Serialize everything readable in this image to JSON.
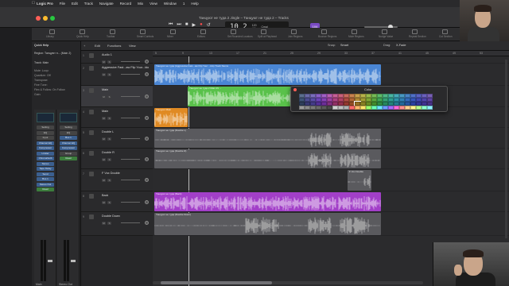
{
  "menubar": {
    "apple": "",
    "items": [
      "Logic Pro",
      "File",
      "Edit",
      "Track",
      "Navigate",
      "Record",
      "Mix",
      "View",
      "Window",
      "1",
      "Help"
    ],
    "clock": ""
  },
  "window": {
    "title": "Танцуют не туда 2 Jingle – Танцуют не туда 2 – Tracks"
  },
  "transport": {
    "buttons": [
      "⏮",
      "⏭",
      "■",
      "▶",
      "●",
      "↺"
    ],
    "bar_beat": "10 2",
    "tempo_small": "120",
    "key_small": "4/4",
    "key_name": "Cmaj",
    "key_badge": "104"
  },
  "toolbar": {
    "tools": [
      {
        "label": "Library",
        "icon": "library-icon"
      },
      {
        "label": "Quick Help",
        "icon": "quick-help-icon"
      },
      {
        "label": "Toolbar",
        "icon": "toolbar-icon"
      },
      {
        "label": "Smart Controls",
        "icon": "smart-controls-icon"
      },
      {
        "label": "Mixer",
        "icon": "mixer-icon"
      },
      {
        "label": "Editors",
        "icon": "editors-icon"
      },
      {
        "label": "Set Rounded Locators",
        "icon": "locators-icon"
      },
      {
        "label": "Split at Playhead",
        "icon": "split-icon"
      },
      {
        "label": "Join Regions",
        "icon": "join-icon"
      },
      {
        "label": "Bounce Regions",
        "icon": "bounce-icon"
      },
      {
        "label": "Mute Regions",
        "icon": "mute-icon"
      },
      {
        "label": "Nudge Value",
        "icon": "nudge-icon"
      },
      {
        "label": "Repeat Section",
        "icon": "repeat-icon"
      },
      {
        "label": "Cut Section",
        "icon": "cut-icon"
      },
      {
        "label": "Insert Silence",
        "icon": "insert-icon"
      }
    ]
  },
  "inspector": {
    "quick_help": "Quick Help",
    "region_label": "Region: Танцуют н... (Main 2)",
    "track_label": "Track: Main",
    "rows": [
      "Mute: Loop:",
      "Quantize: Off",
      "Transpose:",
      "Fine Tune:",
      "Flex & Follow: On Follow",
      "Gain:",
      "Fade In:",
      "Fade Out: Off"
    ],
    "strip1_name": "Main",
    "strip2_name": "Stereo Out",
    "strip1_buttons": [
      "Setting",
      "EQ",
      "Input",
      "Channel EQ",
      "Compressor",
      "Limiter",
      "ChromaVerb",
      "Stereo",
      "Tape Delay",
      "Send",
      "Bus 1",
      "Stereo Out",
      "Read"
    ],
    "strip2_buttons": [
      "Setting",
      "EQ",
      "Bus 1",
      "Channel EQ",
      "Compressor",
      "Group",
      "Read"
    ],
    "strip1_values": [
      "-0.0",
      "0.0"
    ],
    "strip2_values": [
      "0.0",
      "0.0"
    ]
  },
  "arrange_header": {
    "edit": "Edit",
    "functions": "Functions",
    "view": "View",
    "snap_label": "Snap:",
    "snap_value": "Smart",
    "drag_label": "Drag:",
    "drag_value": "X-Fade"
  },
  "ruler": {
    "ticks": [
      "5",
      "9",
      "13",
      "17",
      "21",
      "25",
      "29",
      "33",
      "37",
      "41",
      "45",
      "49",
      "53"
    ]
  },
  "tracks": [
    {
      "num": "1",
      "name": "Audio 1",
      "h": 16
    },
    {
      "num": "2",
      "name": "Aggressive Fast...aw Flip Your...ldo",
      "h": 28
    },
    {
      "num": "3",
      "name": "Main",
      "h": 27
    },
    {
      "num": "4",
      "name": "Main",
      "h": 26
    },
    {
      "num": "5",
      "name": "Double L",
      "h": 26
    },
    {
      "num": "6",
      "name": "Double R",
      "h": 26
    },
    {
      "num": "7",
      "name": "F Vox Double",
      "h": 28
    },
    {
      "num": "8",
      "name": "Back",
      "h": 26
    },
    {
      "num": "9",
      "name": "Double Down",
      "h": 30
    }
  ],
  "regions": [
    {
      "lane": 1,
      "label": "Танцуют не туда (Aggressive Fast...aw Flip Your ...ldo) Track Stems",
      "color": "#4a86d4",
      "start": 2,
      "end": 287
    },
    {
      "lane": 2,
      "label": "Танцуют не туда 2 Main #1 ...",
      "color": "#59c14a",
      "start": 44,
      "end": 287
    },
    {
      "lane": 3,
      "label": "Танцуют Main",
      "color": "#e08a23",
      "start": 2,
      "end": 44
    },
    {
      "lane": 4,
      "label": "Танцуют не туда (Double L)",
      "color": "#5a5a5e",
      "start": 2,
      "end": 287
    },
    {
      "lane": 5,
      "label": "Танцуют не туда (Double R)",
      "color": "#5a5a5e",
      "start": 2,
      "end": 287
    },
    {
      "lane": 6,
      "label": "F Vox Double",
      "color": "#5a5a5e",
      "start": 245,
      "end": 275
    },
    {
      "lane": 7,
      "label": "Танцуют не туда (Back)",
      "color": "#a23fc8",
      "start": 2,
      "end": 287
    },
    {
      "lane": 8,
      "label": "Танцуют не туда (Double Down)",
      "color": "#5a5a5e",
      "start": 2,
      "end": 287
    }
  ],
  "color_popup": {
    "title": "Color",
    "palette": [
      "#5a6e8e",
      "#6a6aa8",
      "#7a6cbc",
      "#8a60c8",
      "#a15fc6",
      "#b85fb4",
      "#c65f96",
      "#c8607a",
      "#c86a5e",
      "#c8824e",
      "#c8a04c",
      "#b8b24a",
      "#9abb4c",
      "#76bb55",
      "#5cbb6a",
      "#4fb886",
      "#48b4a2",
      "#46aab8",
      "#4898c2",
      "#4a84c6",
      "#5070c8",
      "#5a62c2",
      "#6a60bc",
      "#7860b4",
      "#3f5476",
      "#4c4c90",
      "#5a4ea6",
      "#6c44b8",
      "#8642b6",
      "#9e42a0",
      "#ae4282",
      "#b04264",
      "#b04c42",
      "#b06636",
      "#b08834",
      "#a29c34",
      "#80a636",
      "#58a63e",
      "#40a656",
      "#34a274",
      "#2e9e92",
      "#2e94aa",
      "#3080b4",
      "#326aba",
      "#3656ba",
      "#4048b2",
      "#5044aa",
      "#5e44a2",
      "#2e3e5a",
      "#383872",
      "#443c88",
      "#543098",
      "#6c2e98",
      "#823082",
      "#923066",
      "#94304c",
      "#94382e",
      "#944e24",
      "#946e22",
      "#888222",
      "#688c24",
      "#428c2c",
      "#2e8c42",
      "#26885e",
      "#22847a",
      "#227a90",
      "#24689a",
      "#2654a0",
      "#2a42a0",
      "#32369a",
      "#403290",
      "#4a3288",
      "#9a9a9a",
      "#8a8a8a",
      "#7a7a7a",
      "#6a6a6a",
      "#5a5a5a",
      "#4a4a4a",
      "#d0d0d0",
      "#c0c0c0",
      "#b0b0b0",
      "#ff6b6b",
      "#ffb86b",
      "#ffe66b",
      "#9bff6b",
      "#6bffb3",
      "#6be6ff",
      "#6b9bff",
      "#a66bff",
      "#ff6bd9",
      "#ff8f8f",
      "#ffd08f",
      "#fff28f",
      "#b8ff8f",
      "#8fffce",
      "#8ff0ff"
    ]
  }
}
